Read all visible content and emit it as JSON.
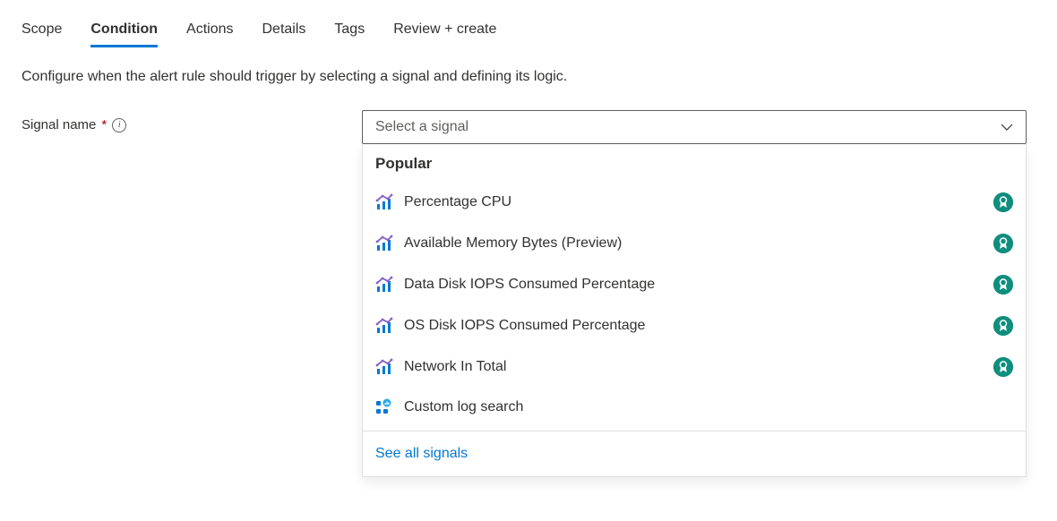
{
  "tabs": [
    {
      "label": "Scope",
      "active": false
    },
    {
      "label": "Condition",
      "active": true
    },
    {
      "label": "Actions",
      "active": false
    },
    {
      "label": "Details",
      "active": false
    },
    {
      "label": "Tags",
      "active": false
    },
    {
      "label": "Review + create",
      "active": false
    }
  ],
  "description": "Configure when the alert rule should trigger by selecting a signal and defining its logic.",
  "signal_field": {
    "label": "Signal name",
    "required_marker": "*",
    "placeholder": "Select a signal"
  },
  "dropdown": {
    "section_title": "Popular",
    "items": [
      {
        "label": "Percentage CPU",
        "icon": "metrics-icon",
        "has_badge": true
      },
      {
        "label": "Available Memory Bytes (Preview)",
        "icon": "metrics-icon",
        "has_badge": true
      },
      {
        "label": "Data Disk IOPS Consumed Percentage",
        "icon": "metrics-icon",
        "has_badge": true
      },
      {
        "label": "OS Disk IOPS Consumed Percentage",
        "icon": "metrics-icon",
        "has_badge": true
      },
      {
        "label": "Network In Total",
        "icon": "metrics-icon",
        "has_badge": true
      },
      {
        "label": "Custom log search",
        "icon": "log-search-icon",
        "has_badge": false
      }
    ],
    "footer_link": "See all signals"
  }
}
